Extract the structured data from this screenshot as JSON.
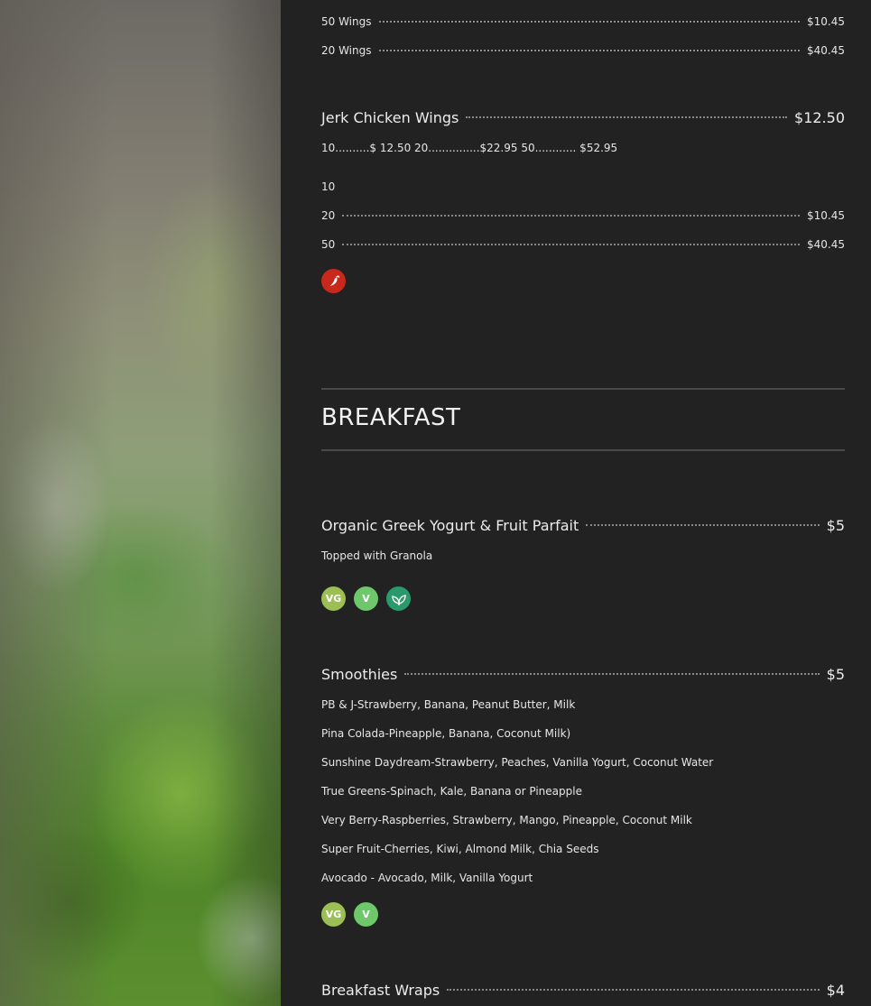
{
  "wings_sizes": [
    {
      "name": "50 Wings",
      "price": "$10.45"
    },
    {
      "name": "20 Wings",
      "price": "$40.45"
    }
  ],
  "jerk": {
    "name": "Jerk Chicken Wings",
    "price": "$12.50",
    "description": "10..........$ 12.50 20...............$22.95 50............ $52.95",
    "first_size": "10",
    "sizes": [
      {
        "name": "20",
        "price": "$10.45"
      },
      {
        "name": "50",
        "price": "$40.45"
      }
    ]
  },
  "section": {
    "title": "BREAKFAST"
  },
  "parfait": {
    "name": "Organic Greek Yogurt & Fruit Parfait",
    "price": "$5",
    "description": "Topped with Granola",
    "badges": [
      "VG",
      "V"
    ]
  },
  "smoothies": {
    "name": "Smoothies",
    "price": "$5",
    "lines": [
      "PB & J-Strawberry, Banana, Peanut Butter, Milk",
      "Pina Colada-Pineapple, Banana, Coconut Milk)",
      "Sunshine Daydream-Strawberry, Peaches, Vanilla Yogurt, Coconut Water",
      "True Greens-Spinach, Kale, Banana or Pineapple",
      "Very Berry-Raspberries, Strawberry, Mango, Pineapple, Coconut Milk",
      "Super Fruit-Cherries, Kiwi, Almond Milk, Chia Seeds",
      "Avocado - Avocado, Milk, Vanilla Yogurt"
    ],
    "badges": [
      "VG",
      "V"
    ]
  },
  "wraps": {
    "name": "Breakfast Wraps",
    "price": "$4"
  },
  "colors": {
    "background": "#222222",
    "vegan_badge": "#9cbf55",
    "vegetarian_badge": "#6ec76a",
    "organic_badge": "#2a9a6c",
    "spicy_badge": "#c9291c"
  },
  "icons": [
    "chili-pepper-icon",
    "leaf-icon"
  ]
}
